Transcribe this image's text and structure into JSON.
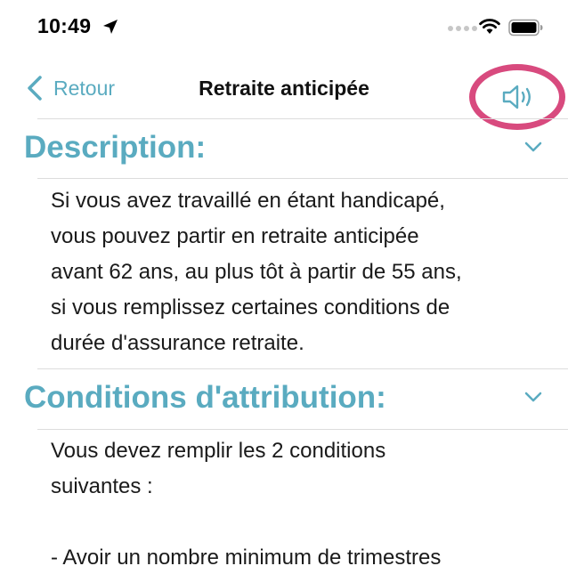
{
  "status_bar": {
    "time": "10:49",
    "icons": [
      "location-arrow-icon",
      "cellular-signal-icon",
      "wifi-icon",
      "battery-icon"
    ]
  },
  "nav": {
    "back_label": "Retour",
    "title": "Retraite anticipée",
    "speaker_icon": "speaker-icon",
    "highlight_color": "#d84a7e"
  },
  "accent_color": "#5aabc0",
  "sections": [
    {
      "title": "Description:",
      "body": "Si vous avez travaillé en étant handicapé,\nvous pouvez partir en retraite anticipée\navant 62 ans, au plus tôt à partir de 55 ans,\nsi vous remplissez certaines conditions de\ndurée d'assurance retraite."
    },
    {
      "title": "Conditions d'attribution:",
      "body": "Vous devez remplir les 2 conditions\nsuivantes :\n\n- Avoir un nombre minimum de trimestres"
    }
  ]
}
